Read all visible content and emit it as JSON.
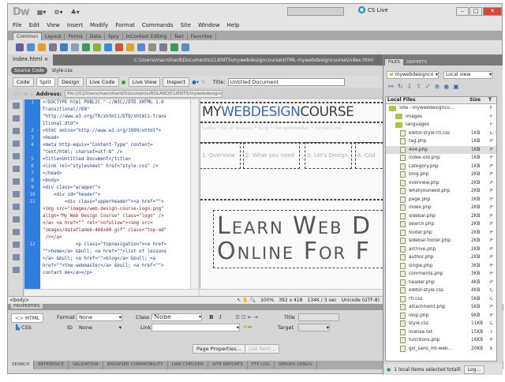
{
  "app": {
    "logo": "Dw",
    "search_placeholder": "",
    "cs_live": "CS Live"
  },
  "menu": [
    "File",
    "Edit",
    "View",
    "Insert",
    "Modify",
    "Format",
    "Commands",
    "Site",
    "Window",
    "Help"
  ],
  "insert_tabs": [
    "Common",
    "Layout",
    "Forms",
    "Data",
    "Spry",
    "InContext Editing",
    "Text",
    "Favorites"
  ],
  "document": {
    "tab": "index.html",
    "close": "×",
    "path": "C:\\Users\\macrohard\\Documents\\CLIENTS\\mywebdesigncourse\\HTML-mywebdesigncourse\\index.html",
    "source_code": "Source Code",
    "related_file": "style.css",
    "toolbar": {
      "code": "Code",
      "split": "Split",
      "design": "Design",
      "live_code": "Live Code",
      "live_view": "Live View",
      "inspect": "Inspect",
      "title_label": "Title:",
      "title_value": "Untitled Document"
    },
    "address_label": "Address:",
    "address": "file:///C|/Users/macrohard/Documents/ROLAND/CLIENTS/mywebdesigncourse/index.html"
  },
  "code_lines": [
    {
      "n": "1",
      "t": "<!DOCTYPE html PUBLIC \"-//W3C//DTD XHTML 1.0"
    },
    {
      "n": "",
      "t": "Transitional//EN\""
    },
    {
      "n": "",
      "t": "\"http://www.w3.org/TR/xhtml1/DTD/xhtml1-trans"
    },
    {
      "n": "",
      "t": "itional.dtd\">"
    },
    {
      "n": "2",
      "t": "<html xmlns=\"http://www.w3.org/1999/xhtml\">"
    },
    {
      "n": "3",
      "t": "<head>"
    },
    {
      "n": "4",
      "t": "<meta http-equiv=\"Content-Type\" content="
    },
    {
      "n": "",
      "t": "\"text/html; charset=utf-8\" />"
    },
    {
      "n": "5",
      "t": "<title>Untitled Document</title>"
    },
    {
      "n": "6",
      "t": "<link rel=\"stylesheet\" href=\"style.css\" />"
    },
    {
      "n": "7",
      "t": "</head>"
    },
    {
      "n": "8",
      "t": "<body>"
    },
    {
      "n": "9",
      "t": "<div class=\"wrapper\">"
    },
    {
      "n": "10",
      "t": "    <div id=\"header\">"
    },
    {
      "n": "11",
      "t": "        <div class=\"upperheader\"><a href=\"\">"
    },
    {
      "n": "",
      "t": "<img src=\"images/web-design-course-logo.png\"",
      "r": true
    },
    {
      "n": "",
      "t": "align=\"My Web Design Course\" class=\"logo\" />",
      "r": true
    },
    {
      "n": "",
      "t": "</a> <a href=\"\" rel=\"nofollow\"><img src=",
      "r": true
    },
    {
      "n": "",
      "t": "\"images/dataflameb-468x60.gif\" class=\"top-ad\"",
      "r": true
    },
    {
      "n": "",
      "t": " /></a>",
      "r": true
    },
    {
      "n": "12",
      "t": "            <p class=\"topnavigation\"><a href="
    },
    {
      "n": "",
      "t": "\"\">home</a> &bull; <a href=\"\">list of lessons"
    },
    {
      "n": "",
      "t": "</a> &bull; <a href=\"\">blog</a> &bull; <a"
    },
    {
      "n": "",
      "t": "href=\"\">the webmaster</a> &bull; <a href=\"\">"
    },
    {
      "n": "",
      "t": "contact me</a></p>"
    }
  ],
  "design": {
    "logo_a": "MY",
    "logo_b": "WEBDESIGN",
    "logo_c": "COURSE",
    "topnav": "home * list of lessons * blog * the webmaster * contact me",
    "nav": [
      "1. Overview",
      "2. What you need",
      "3. Let's Design",
      "4. Cod"
    ],
    "hero1": "Learn Web D",
    "hero2": "Online For F"
  },
  "status": {
    "tag": "<body>",
    "zoom": "100%",
    "size": "392 x 418",
    "weight": "134K / 3 sec",
    "encoding": "Unicode (UTF-8)"
  },
  "properties": {
    "title": "PROPERTIES",
    "html": "HTML",
    "css": "CSS",
    "format_label": "Format",
    "format": "None",
    "id_label": "ID",
    "id": "None",
    "class_label": "Class",
    "class": "None",
    "link_label": "Link",
    "bold": "B",
    "italic": "I",
    "title_label": "Title",
    "target_label": "Target",
    "page_props": "Page Properties...",
    "list_item": "List Item..."
  },
  "bottom_tabs": [
    "SEARCH",
    "REFERENCE",
    "VALIDATION",
    "BROWSER COMPATIBILITY",
    "LINK CHECKER",
    "SITE REPORTS",
    "FTP LOG",
    "SERVER DEBUG"
  ],
  "files": {
    "tabs": [
      "FILES",
      "SNIPPETS"
    ],
    "site": "mywebdesignco",
    "view": "Local view",
    "col_name": "Local Files",
    "col_size": "Size",
    "col_type": "T",
    "items": [
      {
        "n": "Site - mywebdesignco...",
        "s": "",
        "t": "F",
        "k": "folder"
      },
      {
        "n": "images",
        "s": "",
        "t": "F",
        "k": "folder"
      },
      {
        "n": "languages",
        "s": "",
        "t": "F",
        "k": "folder"
      },
      {
        "n": "editor-style-rtl.css",
        "s": "1KB",
        "t": "C"
      },
      {
        "n": "tag.php",
        "s": "1KB",
        "t": "P"
      },
      {
        "n": "404.php",
        "s": "1KB",
        "t": "P",
        "sel": true
      },
      {
        "n": "index-old.php",
        "s": "1KB",
        "t": "P"
      },
      {
        "n": "category.php",
        "s": "1KB",
        "t": "P"
      },
      {
        "n": "blog.php",
        "s": "2KB",
        "t": "P"
      },
      {
        "n": "overview.php",
        "s": "2KB",
        "t": "P"
      },
      {
        "n": "whatyouneed.php",
        "s": "2KB",
        "t": "P"
      },
      {
        "n": "page.php",
        "s": "2KB",
        "t": "P"
      },
      {
        "n": "index.php",
        "s": "2KB",
        "t": "P"
      },
      {
        "n": "sidebar.php",
        "s": "2KB",
        "t": "P"
      },
      {
        "n": "search.php",
        "s": "2KB",
        "t": "P"
      },
      {
        "n": "footer.php",
        "s": "2KB",
        "t": "P"
      },
      {
        "n": "sidebar-footer.php",
        "s": "2KB",
        "t": "P"
      },
      {
        "n": "archive.php",
        "s": "2KB",
        "t": "P"
      },
      {
        "n": "author.php",
        "s": "2KB",
        "t": "P"
      },
      {
        "n": "single.php",
        "s": "3KB",
        "t": "P"
      },
      {
        "n": "comments.php",
        "s": "3KB",
        "t": "P"
      },
      {
        "n": "header.php",
        "s": "4KB",
        "t": "P"
      },
      {
        "n": "editor-style.css",
        "s": "4KB",
        "t": "C"
      },
      {
        "n": "rtl.css",
        "s": "5KB",
        "t": "C"
      },
      {
        "n": "attachment.php",
        "s": "5KB",
        "t": "P"
      },
      {
        "n": "loop.php",
        "s": "9KB",
        "t": "P"
      },
      {
        "n": "style.css",
        "s": "11KB",
        "t": "C"
      },
      {
        "n": "license.txt",
        "s": "15KB",
        "t": "T"
      },
      {
        "n": "functions.php",
        "s": "16KB",
        "t": "P"
      },
      {
        "n": "gill_sans_mt-web...",
        "s": "20KB",
        "t": "E"
      }
    ],
    "status": "1 local items selected totalli",
    "log": "Log..."
  }
}
